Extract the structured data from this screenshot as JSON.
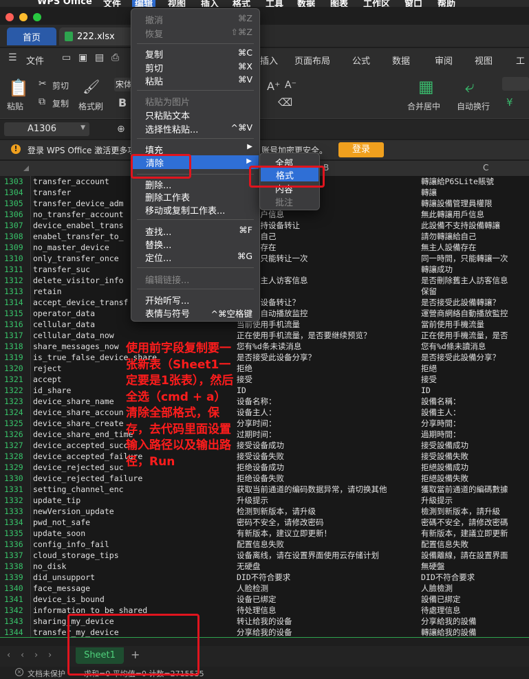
{
  "menubar": {
    "items": [
      "WPS Office",
      "文件",
      "编辑",
      "视图",
      "插入",
      "格式",
      "工具",
      "数据",
      "图表",
      "工作区",
      "窗口",
      "帮助"
    ]
  },
  "tabs": {
    "home": "首页",
    "file": "222.xlsx"
  },
  "ribbon": {
    "tabs": [
      "文件",
      "插入",
      "页面布局",
      "公式",
      "数据",
      "审阅",
      "视图",
      "工具"
    ],
    "buttons": {
      "cut": "剪切",
      "copy": "复制",
      "paste": "粘贴",
      "format_painter": "格式刷",
      "merge": "合并居中",
      "wrap": "自动换行"
    },
    "font_partial": "宋体"
  },
  "formula": {
    "cell_ref": "A1306"
  },
  "notice": {
    "text": "登录 WPS Office 激活更多功",
    "text_tail": "账号加密更安全。",
    "login_button": "登录"
  },
  "columns": {
    "b": "B",
    "c": "C"
  },
  "rows": [
    {
      "n": "1303",
      "a": "transfer_account",
      "b": "",
      "c": "轉讓給P6SLite賬號"
    },
    {
      "n": "1304",
      "a": "transfer",
      "b": "",
      "c": "轉讓"
    },
    {
      "n": "1305",
      "a": "transfer_device_adm",
      "b": "权限",
      "c": "轉讓設備管理員權限"
    },
    {
      "n": "1306",
      "a": "no_transfer_account",
      "b": "转让用户信息",
      "c": "無此轉讓用戶信息"
    },
    {
      "n": "1307",
      "a": "device_enabel_trans",
      "b": "备不支持设备转让",
      "c": "此設備不支持設備轉讓"
    },
    {
      "n": "1308",
      "a": "enabel_transfer_to_",
      "b": "转让给自己",
      "c": "請勿轉讓給自己"
    },
    {
      "n": "1309",
      "a": "no_master_device",
      "b": "人设备存在",
      "c": "無主人設備存在"
    },
    {
      "n": "1310",
      "a": "only_transfer_once",
      "b": "时间，只能转让一次",
      "c": "同一時間，只能轉讓一次"
    },
    {
      "n": "1311",
      "a": "transfer_suc",
      "b": "成功",
      "c": "轉讓成功"
    },
    {
      "n": "1312",
      "a": "delete_visitor_info",
      "b": "删除旧主人访客信息",
      "c": "是否刪除舊主人訪客信息"
    },
    {
      "n": "1313",
      "a": "retain",
      "b": "",
      "c": "保留"
    },
    {
      "n": "1314",
      "a": "accept_device_transf",
      "b": "接受此设备转让？",
      "c": "是否接受此設備轉讓？"
    },
    {
      "n": "1315",
      "a": "operator_data",
      "b": "商网络自动播放监控",
      "c": "運營商網絡自動播放監控"
    },
    {
      "n": "1316",
      "a": "cellular_data",
      "b": "当前使用手机流量",
      "c": "當前使用手機流量"
    },
    {
      "n": "1317",
      "a": "cellular_data_now",
      "b": "正在使用手机流量，是否要继续预览？",
      "c": "正在使用手機流量，是否"
    },
    {
      "n": "1318",
      "a": "share_messages_now",
      "b": "您有%d条未读消息",
      "c": "您有%d條未讀消息"
    },
    {
      "n": "1319",
      "a": "is_true_false_device_share",
      "b": "是否接受此设备分享？",
      "c": "是否接受此設備分享？"
    },
    {
      "n": "1320",
      "a": "reject",
      "b": "拒绝",
      "c": "拒絕"
    },
    {
      "n": "1321",
      "a": "accept",
      "b": "接受",
      "c": "接受"
    },
    {
      "n": "1322",
      "a": "id_share",
      "b": "ID",
      "c": "ID"
    },
    {
      "n": "1323",
      "a": "device_share_name",
      "b": "设备名称：",
      "c": "設備名稱："
    },
    {
      "n": "1324",
      "a": "device_share_accoun",
      "b": "设备主人：",
      "c": "設備主人："
    },
    {
      "n": "1325",
      "a": "device_share_create",
      "b": "分享时间：",
      "c": "分享時間："
    },
    {
      "n": "1326",
      "a": "device_share_end_time",
      "b": "过期时间：",
      "c": "過期時間："
    },
    {
      "n": "1327",
      "a": "device_accepted_succ",
      "b": "接受设备成功",
      "c": "接受設備成功"
    },
    {
      "n": "1328",
      "a": "device_accepted_failure",
      "b": "接受设备失败",
      "c": "接受設備失敗"
    },
    {
      "n": "1329",
      "a": "device_rejected_suc",
      "b": "拒绝设备成功",
      "c": "拒絕設備成功"
    },
    {
      "n": "1330",
      "a": "device_rejected_failure",
      "b": "拒绝设备失败",
      "c": "拒絕設備失敗"
    },
    {
      "n": "1331",
      "a": "setting_channel_enc",
      "b": "获取当前通道的编码数据异常，请切换其他",
      "c": "獲取當前通道的編碼數據"
    },
    {
      "n": "1332",
      "a": "update_tip",
      "b": "升级提示",
      "c": "升級提示"
    },
    {
      "n": "1333",
      "a": "newVersion_update",
      "b": "检测到新版本，请升级",
      "c": "檢測到新版本，請升級"
    },
    {
      "n": "1334",
      "a": "pwd_not_safe",
      "b": "密码不安全，请修改密码",
      "c": "密碼不安全，請修改密碼"
    },
    {
      "n": "1335",
      "a": "update_soon",
      "b": "有新版本，建议立即更新！",
      "c": "有新版本，建議立即更新"
    },
    {
      "n": "1336",
      "a": "config_info_fail",
      "b": "配置信息失败",
      "c": "配置信息失敗"
    },
    {
      "n": "1337",
      "a": "cloud_storage_tips",
      "b": "设备离线，请在设置界面使用云存储计划",
      "c": "設備離線，請在設置界面"
    },
    {
      "n": "1338",
      "a": "no_disk",
      "b": "无硬盘",
      "c": "無硬盤"
    },
    {
      "n": "1339",
      "a": "did_unsupport",
      "b": "DID不符合要求",
      "c": "DID不符合要求"
    },
    {
      "n": "1340",
      "a": "face_message",
      "b": "人脸检测",
      "c": "人臉檢測"
    },
    {
      "n": "1341",
      "a": "device_is_bound",
      "b": "设备已绑定",
      "c": "設備已綁定"
    },
    {
      "n": "1342",
      "a": "information_to_be_shared",
      "b": "待处理信息",
      "c": "待處理信息"
    },
    {
      "n": "1343",
      "a": "sharing_my_device",
      "b": "转让给我的设备",
      "c": "分享給我的設備"
    },
    {
      "n": "1344",
      "a": "transfer_my_device",
      "b": "分享给我的设备",
      "c": "轉讓給我的設備"
    },
    {
      "n": "1345",
      "a": "",
      "b": "",
      "c": ""
    }
  ],
  "edit_menu": {
    "undo": "撤消",
    "undo_key": "⌘Z",
    "redo": "恢复",
    "redo_key": "⇧⌘Z",
    "copy": "复制",
    "copy_key": "⌘C",
    "cut": "剪切",
    "cut_key": "⌘X",
    "paste": "粘贴",
    "paste_key": "⌘V",
    "paste_as_image": "粘贴为图片",
    "paste_text_only": "只粘贴文本",
    "paste_special": "选择性粘贴...",
    "paste_special_key": "^⌘V",
    "fill": "填充",
    "clear": "清除",
    "delete": "删除...",
    "delete_sheet": "删除工作表",
    "move_copy_sheet": "移动或复制工作表...",
    "find": "查找...",
    "find_key": "⌘F",
    "replace": "替换...",
    "goto": "定位...",
    "goto_key": "⌘G",
    "edit_links": "编辑链接...",
    "dictation": "开始听写...",
    "emoji": "表情与符号",
    "emoji_key": "^⌘空格键"
  },
  "clear_submenu": {
    "all": "全部",
    "formats": "格式",
    "contents": "内容",
    "comments": "批注"
  },
  "annotation": "使用前字段复制要一张新表（Sheet1一定要是1张表），然后全选（cmd + a）清除全部格式，保存，去代码里面设置输入路径以及输出路径，Run",
  "sheet": {
    "name": "Sheet1",
    "add": "+"
  },
  "status": {
    "protect": "文档未保护",
    "stats": "求和=0  平均值=0  计数=2715535"
  },
  "colors": {
    "accent": "#2f6fd6",
    "highlight": "#e0141e",
    "login": "#f0a01e",
    "row_number": "#38c46a"
  }
}
